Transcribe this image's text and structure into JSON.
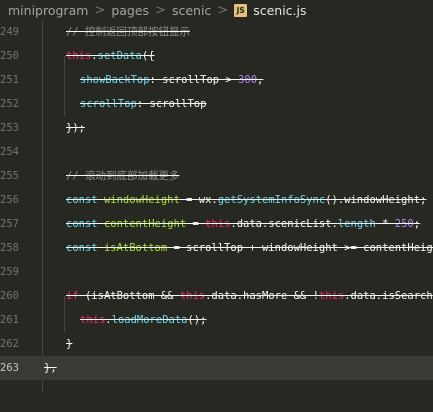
{
  "breadcrumb": {
    "items": [
      "miniprogram",
      "pages",
      "scenic"
    ],
    "separator": ">",
    "file_badge": "JS",
    "file_name": "scenic.js"
  },
  "editor": {
    "current_line": 263,
    "lines": [
      {
        "num": "249",
        "segments": [
          {
            "c": "t-comment",
            "t": "// 控制返回顶部按钮显示"
          }
        ]
      },
      {
        "num": "250",
        "segments": [
          {
            "c": "t-kw",
            "t": "this"
          },
          {
            "c": "t-plain",
            "t": "."
          },
          {
            "c": "t-fn",
            "t": "setData"
          },
          {
            "c": "t-plain",
            "t": "({"
          }
        ]
      },
      {
        "num": "251",
        "segments": [
          {
            "c": "t-key",
            "t": "showBackTop"
          },
          {
            "c": "t-plain",
            "t": ": scrollTop > "
          },
          {
            "c": "t-num",
            "t": "300"
          },
          {
            "c": "t-plain",
            "t": ","
          }
        ]
      },
      {
        "num": "252",
        "segments": [
          {
            "c": "t-key",
            "t": "scrollTop"
          },
          {
            "c": "t-plain",
            "t": ": scrollTop"
          }
        ]
      },
      {
        "num": "253",
        "segments": [
          {
            "c": "t-plain",
            "t": "});"
          }
        ]
      },
      {
        "num": "254",
        "segments": []
      },
      {
        "num": "255",
        "segments": [
          {
            "c": "t-comment",
            "t": "// 滚动到底部加载更多"
          }
        ]
      },
      {
        "num": "256",
        "segments": [
          {
            "c": "t-const",
            "t": "const"
          },
          {
            "c": "t-plain",
            "t": " "
          },
          {
            "c": "t-var",
            "t": "windowHeight"
          },
          {
            "c": "t-plain",
            "t": " = wx."
          },
          {
            "c": "t-fn",
            "t": "getSystemInfoSync"
          },
          {
            "c": "t-plain",
            "t": "().windowHeight;"
          }
        ]
      },
      {
        "num": "257",
        "segments": [
          {
            "c": "t-const",
            "t": "const"
          },
          {
            "c": "t-plain",
            "t": " "
          },
          {
            "c": "t-var",
            "t": "contentHeight"
          },
          {
            "c": "t-plain",
            "t": " = "
          },
          {
            "c": "t-kw",
            "t": "this"
          },
          {
            "c": "t-plain",
            "t": ".data.scenicList."
          },
          {
            "c": "t-fn",
            "t": "length"
          },
          {
            "c": "t-plain",
            "t": " * "
          },
          {
            "c": "t-num",
            "t": "250"
          },
          {
            "c": "t-plain",
            "t": ";"
          }
        ]
      },
      {
        "num": "258",
        "segments": [
          {
            "c": "t-const",
            "t": "const"
          },
          {
            "c": "t-plain",
            "t": " "
          },
          {
            "c": "t-var",
            "t": "isAtBottom"
          },
          {
            "c": "t-plain",
            "t": " = scrollTop + windowHeight >= contentHeight"
          }
        ]
      },
      {
        "num": "259",
        "segments": []
      },
      {
        "num": "260",
        "segments": [
          {
            "c": "t-kw",
            "t": "if"
          },
          {
            "c": "t-plain",
            "t": " (isAtBottom && "
          },
          {
            "c": "t-kw",
            "t": "this"
          },
          {
            "c": "t-plain",
            "t": ".data.hasMore && !"
          },
          {
            "c": "t-kw",
            "t": "this"
          },
          {
            "c": "t-plain",
            "t": ".data.isSearch"
          }
        ]
      },
      {
        "num": "261",
        "segments": [
          {
            "c": "t-kw",
            "t": "this"
          },
          {
            "c": "t-plain",
            "t": "."
          },
          {
            "c": "t-fn",
            "t": "loadMoreData"
          },
          {
            "c": "t-plain",
            "t": "();"
          }
        ]
      },
      {
        "num": "262",
        "segments": [
          {
            "c": "t-plain",
            "t": "}"
          }
        ]
      },
      {
        "num": "263",
        "segments": [
          {
            "c": "t-plain",
            "t": "},"
          }
        ]
      }
    ]
  }
}
